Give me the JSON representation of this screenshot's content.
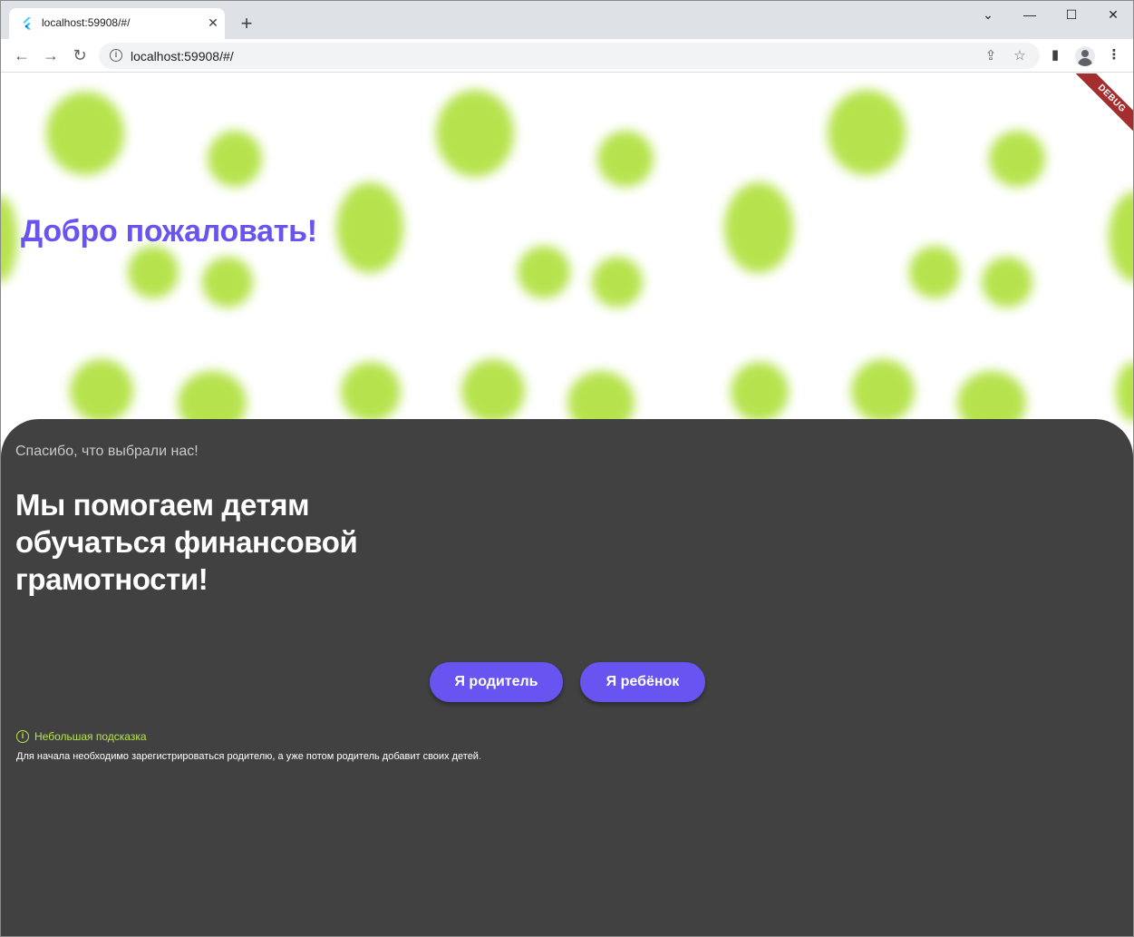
{
  "browser": {
    "tab_title": "localhost:59908/#/",
    "tab_close": "✕",
    "new_tab": "+",
    "url": "localhost:59908/#/",
    "window_controls": {
      "dropdown": "⌄",
      "minimize": "—",
      "maximize": "☐",
      "close": "✕"
    },
    "nav": {
      "back": "←",
      "forward": "→",
      "reload": "↻"
    },
    "icons": {
      "info": "i",
      "share": "⇪",
      "bookmark": "☆",
      "side_panel": "▮",
      "menu": "⋮"
    }
  },
  "app": {
    "debug_banner": "DEBUG",
    "welcome_title": "Добро пожаловать!",
    "thanks_text": "Спасибо, что выбрали нас!",
    "headline": "Мы помогаем детям обучаться финансовой грамотности!",
    "parent_button": "Я родитель",
    "child_button": "Я ребёнок",
    "hint_icon": "i",
    "hint_title": "Небольшая подсказка",
    "hint_text": "Для начала необходимо зарегистрироваться родителю, а уже потом родитель добавит своих детей."
  },
  "colors": {
    "accent": "#6754f1",
    "blob": "#b6e34d",
    "sheet": "#414141",
    "debug": "#a42e2e"
  }
}
